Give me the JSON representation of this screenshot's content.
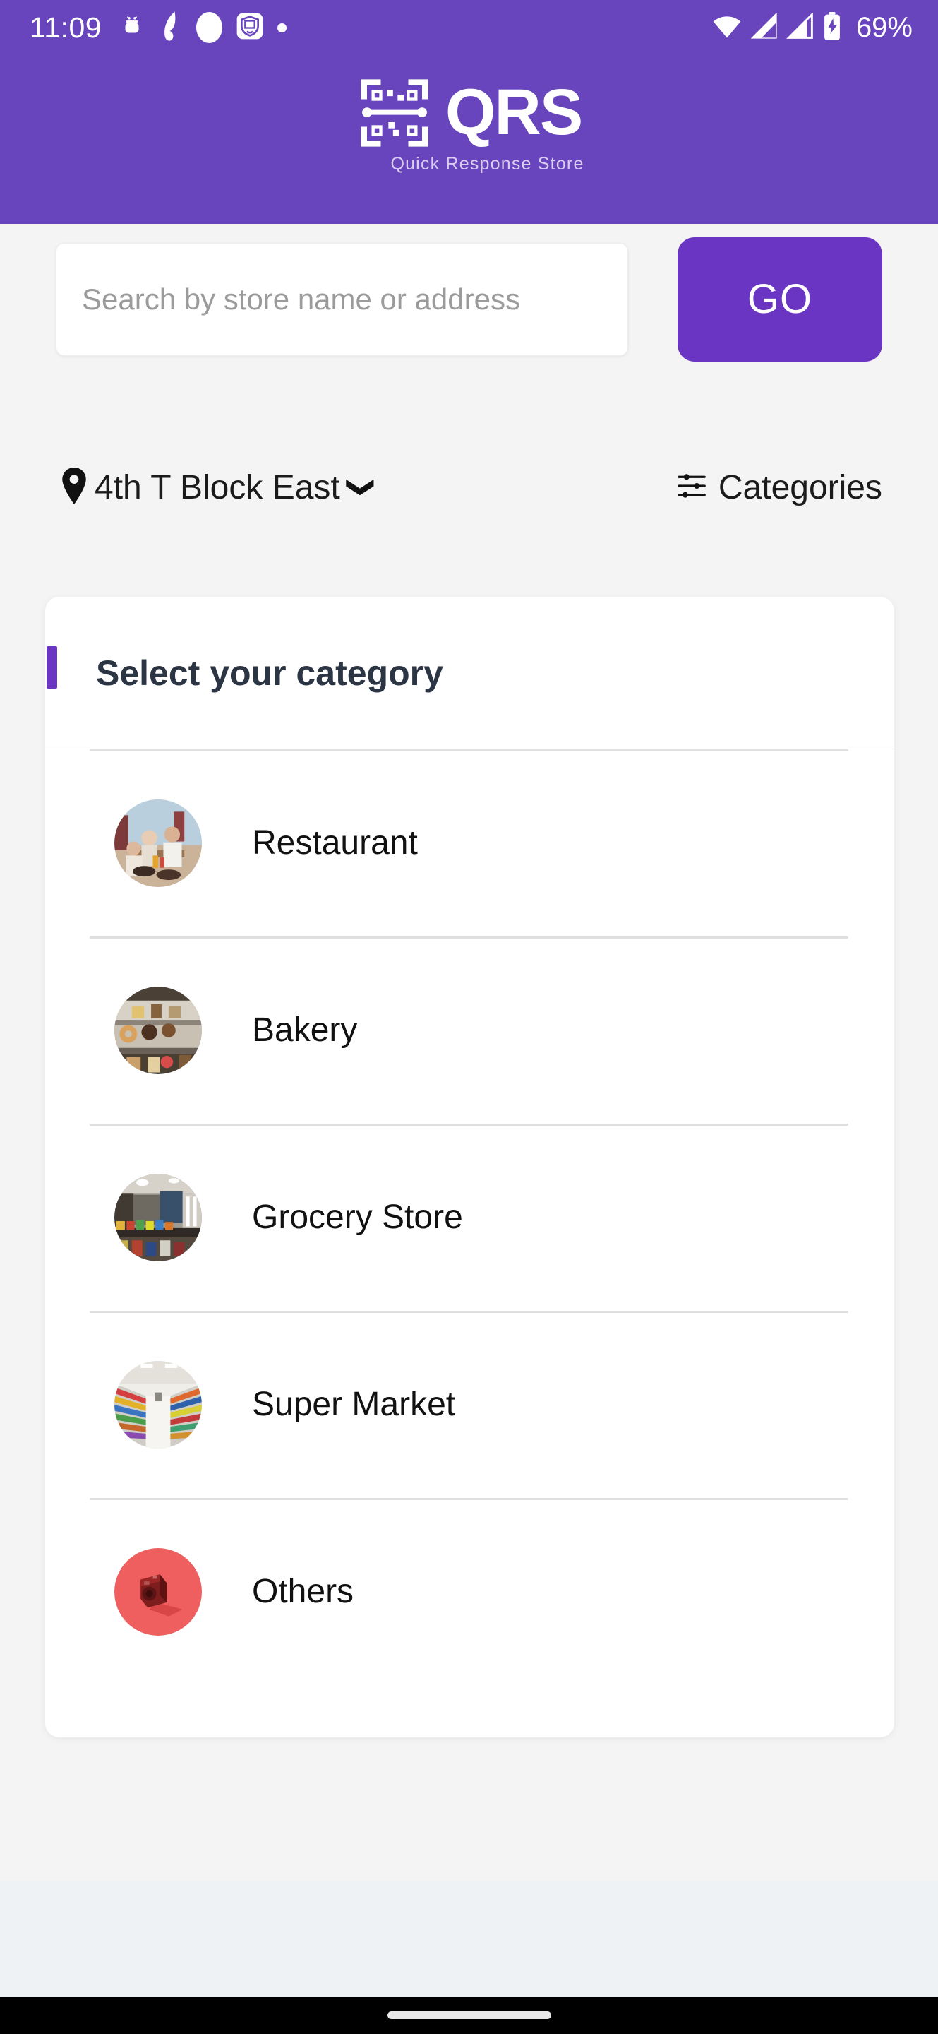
{
  "status_bar": {
    "time": "11:09",
    "battery_text": "69%",
    "left_icons": [
      "android-debug-icon",
      "app-swirl-icon",
      "circle-notification-icon",
      "shield-app-icon",
      "more-notifications-dot-icon"
    ],
    "right_icons": [
      "wifi-icon",
      "signal-bars-icon-1",
      "signal-bars-icon-2",
      "battery-charging-icon"
    ]
  },
  "app_bar": {
    "logo_icon": "qr-code-icon",
    "brand": "QRS",
    "tagline": "Quick Response Store",
    "background_color": "#6945bd"
  },
  "search": {
    "placeholder": "Search by store name or address",
    "value": "",
    "go_label": "GO",
    "go_color": "#6b35c4"
  },
  "meta": {
    "location_icon": "map-pin-icon",
    "location": "4th T Block East",
    "chevron_icon": "chevron-down-icon",
    "categories_icon": "filter-sliders-icon",
    "categories_label": "Categories"
  },
  "category_card": {
    "title": "Select your category",
    "accent_color": "#6b35c4",
    "items": [
      {
        "label": "Restaurant",
        "thumb": "restaurant-photo-thumb"
      },
      {
        "label": "Bakery",
        "thumb": "bakery-photo-thumb"
      },
      {
        "label": "Grocery Store",
        "thumb": "grocery-store-photo-thumb"
      },
      {
        "label": "Super Market",
        "thumb": "super-market-photo-thumb"
      },
      {
        "label": "Others",
        "thumb": "others-red-camera-thumb"
      }
    ]
  },
  "system_nav": {
    "home_indicator": "home-indicator-pill"
  }
}
